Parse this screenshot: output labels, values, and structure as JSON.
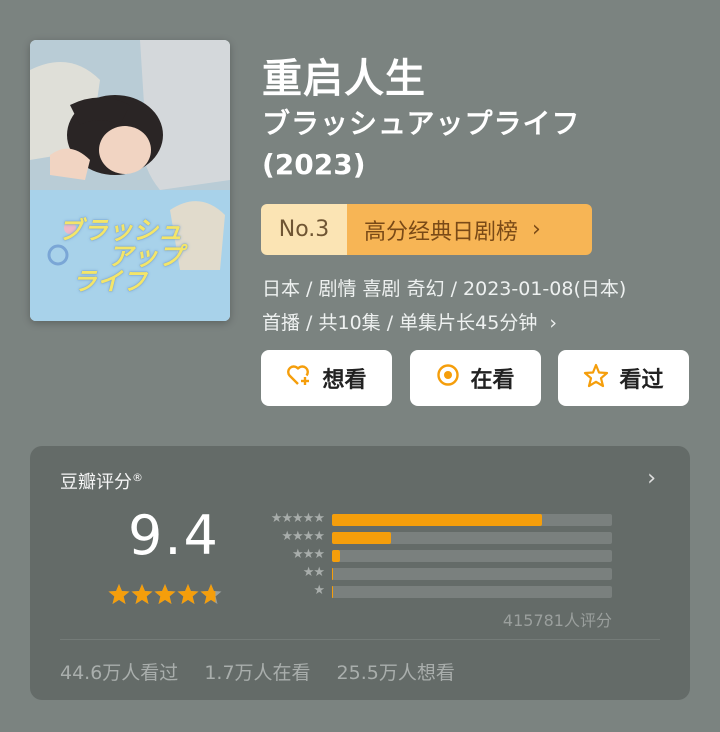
{
  "title": "重启人生",
  "subtitle": "ブラッシュアップライフ",
  "year": "(2023)",
  "poster": {
    "logo_text": [
      "ブラッシュ",
      "アップ",
      "ライフ"
    ]
  },
  "rank": {
    "number": "No.3",
    "list": "高分经典日剧榜",
    "chevron": "›"
  },
  "meta": {
    "line1": "日本 / 剧情 喜剧 奇幻 / 2023-01-08(日本)",
    "line2": "首播 / 共10集 / 单集片长45分钟",
    "chevron": "›"
  },
  "actions": [
    {
      "label": "想看",
      "icon": "heart-plus-icon"
    },
    {
      "label": "在看",
      "icon": "target-icon"
    },
    {
      "label": "看过",
      "icon": "star-outline-icon"
    }
  ],
  "rating": {
    "header": "豆瓣评分",
    "header_mark": "®",
    "arrow": "›",
    "score": "9.4",
    "star_value": 4.7,
    "distribution_pct": [
      75,
      21,
      3,
      0.5,
      0.2
    ],
    "count_text": "415781人评分",
    "stats": [
      "44.6万人看过",
      "1.7万人在看",
      "25.5万人想看"
    ]
  },
  "colors": {
    "accent": "#f59e0b",
    "background": "#7b8380",
    "card": "#646b68"
  }
}
